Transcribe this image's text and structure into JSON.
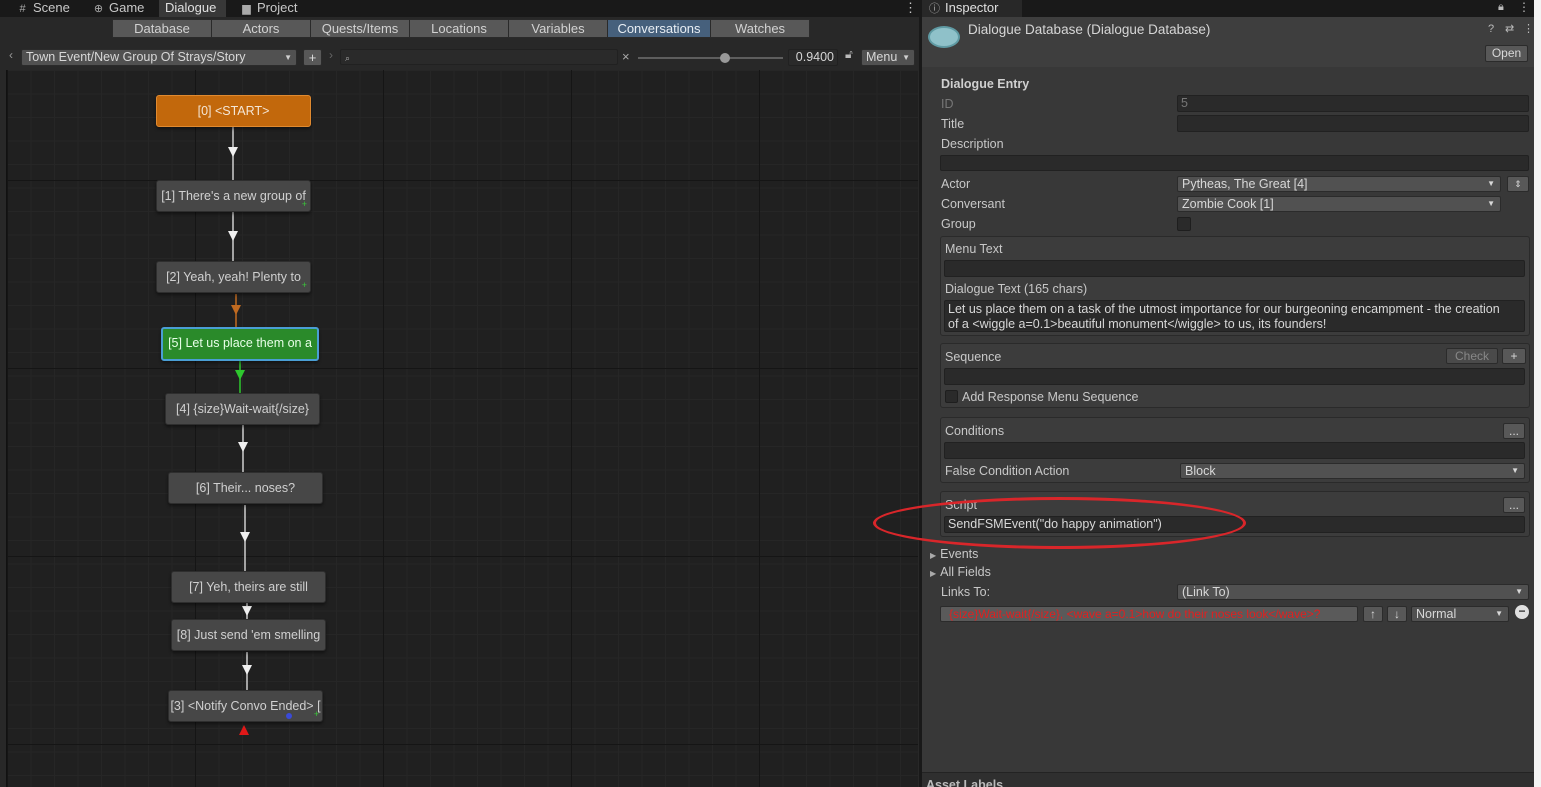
{
  "window_tabs": {
    "scene": "Scene",
    "game": "Game",
    "dialogue": "Dialogue",
    "project": "Project",
    "inspector": "Inspector"
  },
  "db_tabs": [
    "Database",
    "Actors",
    "Quests/Items",
    "Locations",
    "Variables",
    "Conversations",
    "Watches"
  ],
  "selected_db_tab": "Conversations",
  "toolbar": {
    "conversation": "Town Event/New Group Of Strays/Story",
    "add": "+",
    "search_placeholder": "",
    "clear": "×",
    "zoom_level": 0.94,
    "zoom_text": "0.9400",
    "menu": "Menu"
  },
  "nodes": [
    {
      "label": "[0] <START>"
    },
    {
      "label": "[1] There's a new group of"
    },
    {
      "label": "[2] Yeah, yeah! Plenty to"
    },
    {
      "label": "[5] Let us place them on a"
    },
    {
      "label": "[4] {size}Wait-wait{/size}"
    },
    {
      "label": "[6] Their... noses?"
    },
    {
      "label": "[7] Yeh, theirs are still"
    },
    {
      "label": "[8] Just send 'em smelling"
    },
    {
      "label": "[3] <Notify Convo Ended> ["
    }
  ],
  "inspector": {
    "title": "Dialogue Database (Dialogue Database)",
    "open_button": "Open",
    "section_title": "Dialogue Entry",
    "id_label": "ID",
    "id_value": "5",
    "title_label": "Title",
    "title_value": "",
    "description_label": "Description",
    "description_value": "",
    "actor_label": "Actor",
    "actor_value": "Pytheas, The Great [4]",
    "conversant_label": "Conversant",
    "conversant_value": "Zombie Cook [1]",
    "group_label": "Group",
    "menu_text_label": "Menu Text",
    "menu_text_value": "",
    "dialogue_text_label": "Dialogue Text (165 chars)",
    "dialogue_text_line1": "Let us place them on a task of the utmost importance for our burgeoning encampment - the creation",
    "dialogue_text_line2": "of a <wiggle a=0.1>beautiful monument</wiggle> to us, its founders!",
    "sequence_label": "Sequence",
    "check_button": "Check",
    "plus_button": "+",
    "sequence_value": "",
    "add_response_label": "Add Response Menu Sequence",
    "conditions_label": "Conditions",
    "conditions_value": "",
    "ellipsis": "...",
    "false_condition_label": "False Condition Action",
    "false_condition_value": "Block",
    "script_label": "Script",
    "script_value": "SendFSMEvent(\"do happy animation\")",
    "events_label": "Events",
    "all_fields_label": "All Fields",
    "links_to_label": "Links To:",
    "links_to_value": "(Link To)",
    "link_text": "{size}Wait-wait{/size}, <wave a=0.1>how do their noses look</wave>?",
    "link_priority": "Normal",
    "asset_labels": "Asset Labels"
  }
}
